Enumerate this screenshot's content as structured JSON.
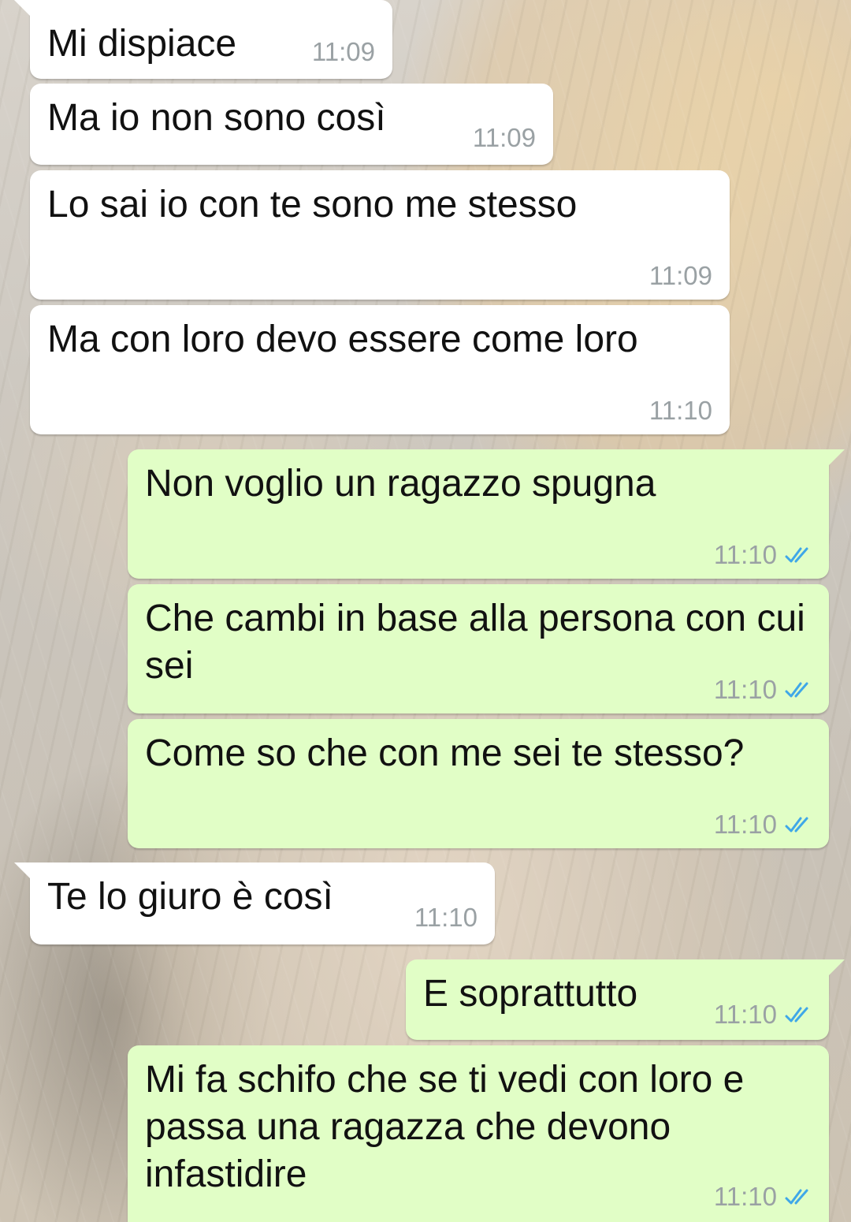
{
  "theme": {
    "incoming_bubble": "#ffffff",
    "outgoing_bubble": "#e1fec6",
    "time_color": "#9aa1a4",
    "read_ticks_color": "#3fa7e8"
  },
  "messages": [
    {
      "direction": "incoming",
      "text": "Mi dispiace",
      "time": "11:09"
    },
    {
      "direction": "incoming",
      "text": "Ma io non sono così",
      "time": "11:09"
    },
    {
      "direction": "incoming",
      "text": "Lo sai io con te sono me stesso",
      "time": "11:09"
    },
    {
      "direction": "incoming",
      "text": "Ma con loro devo essere come loro",
      "time": "11:10"
    },
    {
      "direction": "outgoing",
      "text": "Non voglio un ragazzo spugna",
      "time": "11:10",
      "status_icon": "double-check-read-icon"
    },
    {
      "direction": "outgoing",
      "text": "Che cambi in base alla persona con cui sei",
      "time": "11:10",
      "status_icon": "double-check-read-icon"
    },
    {
      "direction": "outgoing",
      "text": "Come so che con me sei te stesso?",
      "time": "11:10",
      "status_icon": "double-check-read-icon"
    },
    {
      "direction": "incoming",
      "text": "Te lo giuro è così",
      "time": "11:10"
    },
    {
      "direction": "outgoing",
      "text": "E soprattutto",
      "time": "11:10",
      "status_icon": "double-check-read-icon"
    },
    {
      "direction": "outgoing",
      "text": "Mi fa schifo che se ti vedi con loro e passa una ragazza che devono infastidire",
      "time": "11:10",
      "status_icon": "double-check-read-icon"
    }
  ]
}
